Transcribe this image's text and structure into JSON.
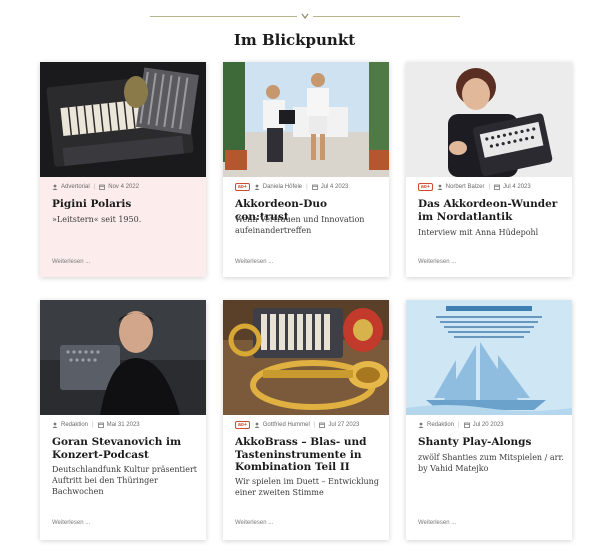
{
  "section": {
    "title": "Im Blickpunkt"
  },
  "colors": {
    "badge": "#cf4a2f",
    "advertorial_bg": "#fcedec",
    "divider": "#b9b18a"
  },
  "cards": [
    {
      "badge": "",
      "author": "Advertorial",
      "date": "Nov 4 2022",
      "title": "Pigini Polaris",
      "excerpt": "»Leitstern« seit 1950.",
      "more": "Weiterlesen ..."
    },
    {
      "badge": "ao+",
      "author": "Daniela Höfele",
      "date": "Jul 4 2023",
      "title": "Akkordeon-Duo con:trust",
      "excerpt": "Wenn Vertrauen und Innovation aufeinandertreffen",
      "more": "Weiterlesen ..."
    },
    {
      "badge": "ao+",
      "author": "Norbert Balzer",
      "date": "Jul 4 2023",
      "title": "Das Akkordeon-Wunder im Nordatlantik",
      "excerpt": "Interview mit Anna Hüdepohl",
      "more": "Weiterlesen ..."
    },
    {
      "badge": "",
      "author": "Redaktion",
      "date": "Mai 31 2023",
      "title": "Goran Stevanovich im Konzert-Podcast",
      "excerpt": "Deutschlandfunk Kultur präsentiert Auftritt bei den Thüringer Bachwochen",
      "more": "Weiterlesen ..."
    },
    {
      "badge": "ao+",
      "author": "Gottfried Hummel",
      "date": "Jul 27 2023",
      "title": "AkkoBrass – Blas- und Tasteninstrumente in Kombination Teil II",
      "excerpt": "Wir spielen im Duett – Entwicklung einer zweiten Stimme",
      "more": "Weiterlesen ..."
    },
    {
      "badge": "",
      "author": "Redaktion",
      "date": "Jul 20 2023",
      "title": "Shanty Play-Alongs",
      "excerpt": "zwölf Shanties zum Mitspielen / arr. by Vahid Matejko",
      "more": "Weiterlesen ..."
    }
  ]
}
